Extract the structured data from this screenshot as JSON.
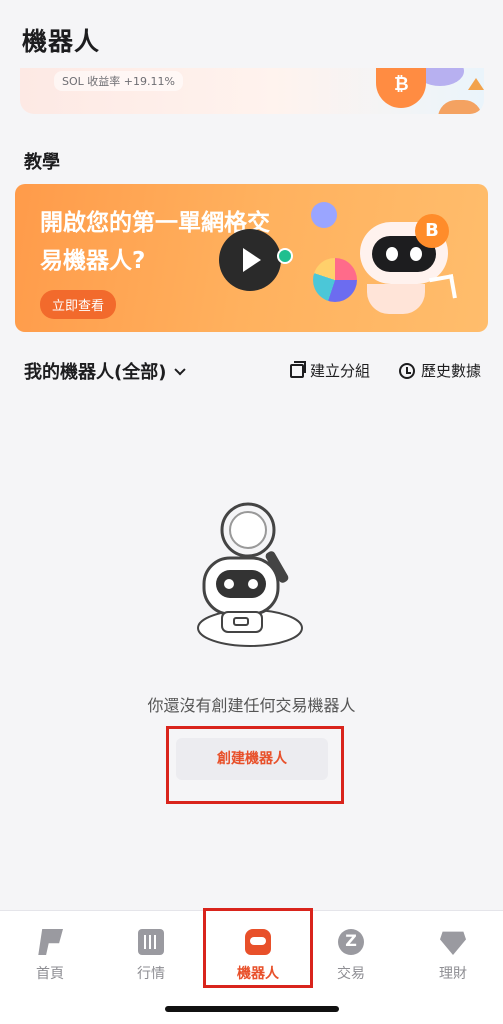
{
  "header": {
    "title": "機器人"
  },
  "promo": {
    "stat_text": "SOL 收益率 +19.11%",
    "coin_symbol": "₿"
  },
  "tutorial": {
    "section_title": "教學",
    "headline": "開啟您的第一單網格交易機器人?",
    "button_label": "立即查看",
    "coin_symbol": "B"
  },
  "my_bots": {
    "title": "我的機器人(全部)",
    "create_group_label": "建立分組",
    "history_label": "歷史數據",
    "empty_text": "你還沒有創建任何交易機器人",
    "create_button_label": "創建機器人"
  },
  "bottom_nav": {
    "items": [
      {
        "label": "首頁",
        "icon": "home-icon"
      },
      {
        "label": "行情",
        "icon": "market-icon"
      },
      {
        "label": "機器人",
        "icon": "robot-icon",
        "active": true
      },
      {
        "label": "交易",
        "icon": "trade-icon"
      },
      {
        "label": "理財",
        "icon": "finance-icon"
      }
    ]
  },
  "colors": {
    "accent": "#e8502a",
    "highlight_border": "#d9241c",
    "banner_orange": "#ff9b4a"
  }
}
